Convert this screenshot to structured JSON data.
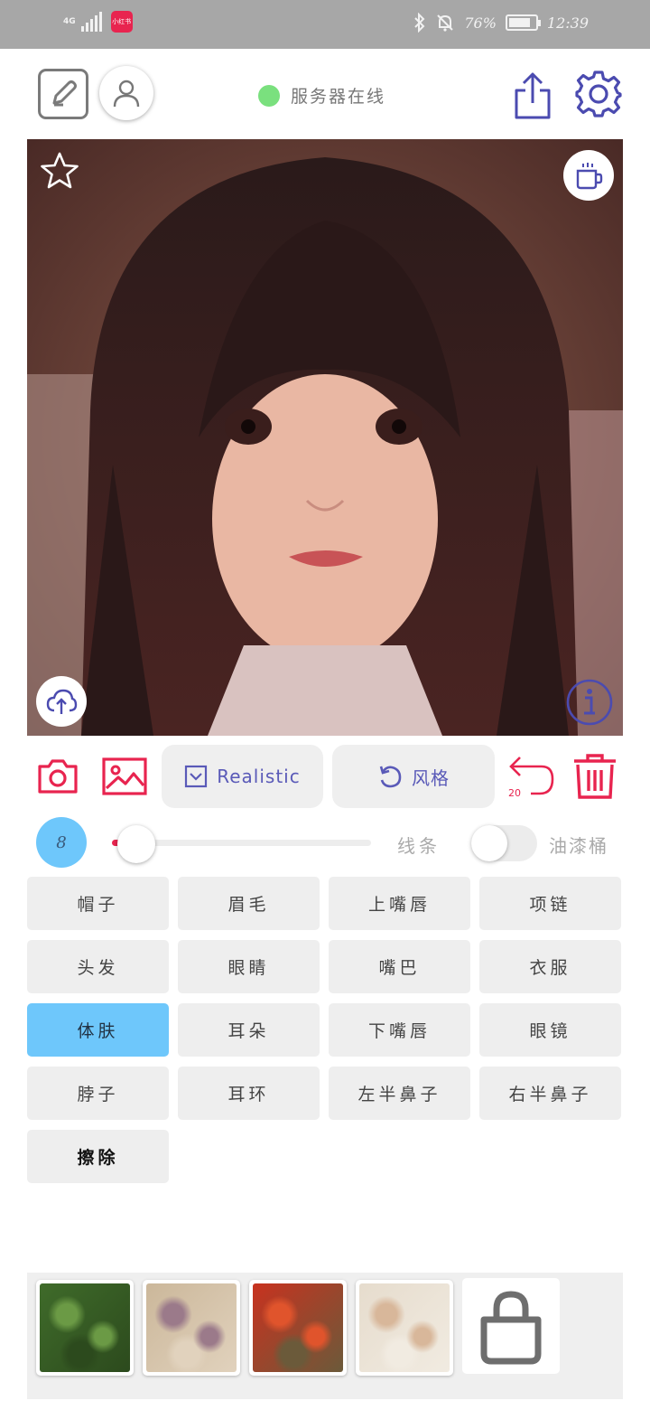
{
  "status_bar": {
    "network": "4G",
    "app_badge": "小红书",
    "battery": "76%",
    "time": "12:39"
  },
  "header": {
    "server_status": "服务器在线",
    "server_status_color": "#7ae07e"
  },
  "toolbar": {
    "model_label": "Realistic",
    "style_label": "风格",
    "undo_count": "20"
  },
  "brush": {
    "size": "8",
    "level_fraction": 0.03,
    "line_label": "线条",
    "bucket_label": "油漆桶",
    "bucket_enabled": false
  },
  "parts": [
    {
      "label": "帽子",
      "active": false
    },
    {
      "label": "眉毛",
      "active": false
    },
    {
      "label": "上嘴唇",
      "active": false
    },
    {
      "label": "项链",
      "active": false
    },
    {
      "label": "头发",
      "active": false
    },
    {
      "label": "眼睛",
      "active": false
    },
    {
      "label": "嘴巴",
      "active": false
    },
    {
      "label": "衣服",
      "active": false
    },
    {
      "label": "体肤",
      "active": true
    },
    {
      "label": "耳朵",
      "active": false
    },
    {
      "label": "下嘴唇",
      "active": false
    },
    {
      "label": "眼镜",
      "active": false
    },
    {
      "label": "脖子",
      "active": false
    },
    {
      "label": "耳环",
      "active": false
    },
    {
      "label": "左半鼻子",
      "active": false
    },
    {
      "label": "右半鼻子",
      "active": false
    },
    {
      "label": "擦除",
      "active": false
    }
  ],
  "textures": [
    {
      "name": "green-foliage",
      "colors": [
        "#3f6b2a",
        "#6b9a45",
        "#2c4a1d"
      ]
    },
    {
      "name": "beige-lace",
      "colors": [
        "#cbb79a",
        "#9b7a8a",
        "#e1d2bd"
      ]
    },
    {
      "name": "red-flowers",
      "colors": [
        "#c8321f",
        "#e0542c",
        "#6b5a3a"
      ]
    },
    {
      "name": "cream-pattern",
      "colors": [
        "#e6dccd",
        "#d8b79a",
        "#f1ebe1"
      ]
    }
  ],
  "colors": {
    "accent_red": "#e8244f",
    "accent_blue": "#5a5ab8",
    "active_chip": "#6ec7fb"
  }
}
